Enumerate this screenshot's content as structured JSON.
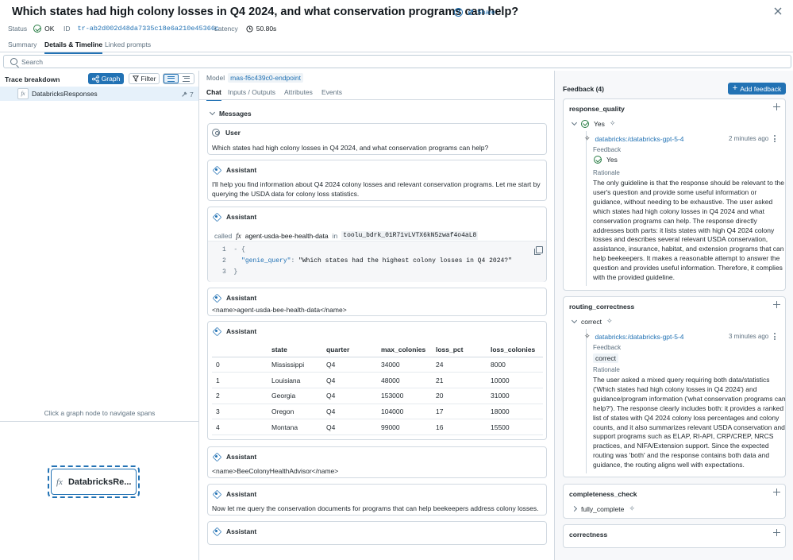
{
  "header": {
    "title": "Which states had high colony losses in Q4 2024, and what conservation programs can help?",
    "help_glyph": "?",
    "share_label": "Share",
    "status_label": "Status",
    "status_value": "OK",
    "id_label": "ID",
    "id_value": "tr-ab2d002d48da7335c18e6a210e45366c",
    "latency_label": "Latency",
    "latency_value": "50.80s",
    "tabs": [
      "Summary",
      "Details & Timeline",
      "Linked prompts"
    ],
    "active_tab": "Details & Timeline"
  },
  "search": {
    "placeholder": "Search"
  },
  "left": {
    "title": "Trace breakdown",
    "graph_label": "Graph",
    "filter_label": "Filter",
    "span_name": "DatabricksResponses",
    "span_count": "7",
    "graph_hint": "Click a graph node to navigate spans",
    "graph_node_label": "DatabricksRe..."
  },
  "middle": {
    "model_label": "Model",
    "model_value": "mas-f6c439c0-endpoint",
    "tabs": [
      "Chat",
      "Inputs / Outputs",
      "Attributes",
      "Events"
    ],
    "messages_label": "Messages",
    "user_role": "User",
    "assistant_role": "Assistant",
    "user_message": "Which states had high colony losses in Q4 2024, and what conservation programs can help?",
    "assistant_1": "I'll help you find information about Q4 2024 colony losses and relevant conservation programs. Let me start by querying the USDA data for colony loss statistics.",
    "called_label": "called",
    "tool_name": "agent-usda-bee-health-data",
    "in_label": "in",
    "tool_call_id": "toolu_bdrk_01R71vLVTX6kN5zwaf4o4aL8",
    "code_line1_num": "1",
    "code_line1": "- {",
    "code_line2_num": "2",
    "code_key": "\"genie_query\"",
    "code_value": "\"Which states had the highest colony losses in Q4 2024?\"",
    "code_line3_num": "3",
    "code_line3": "}",
    "assistant_name_1": "<name>agent-usda-bee-health-data</name>",
    "table": {
      "headers": [
        "",
        "state",
        "quarter",
        "max_colonies",
        "loss_pct",
        "loss_colonies"
      ],
      "rows": [
        [
          "0",
          "Mississippi",
          "Q4",
          "34000",
          "24",
          "8000"
        ],
        [
          "1",
          "Louisiana",
          "Q4",
          "48000",
          "21",
          "10000"
        ],
        [
          "2",
          "Georgia",
          "Q4",
          "153000",
          "20",
          "31000"
        ],
        [
          "3",
          "Oregon",
          "Q4",
          "104000",
          "17",
          "18000"
        ],
        [
          "4",
          "Montana",
          "Q4",
          "99000",
          "16",
          "15500"
        ]
      ]
    },
    "assistant_name_2": "<name>BeeColonyHealthAdvisor</name>",
    "assistant_2": "Now let me query the conservation documents for programs that can help beekeepers address colony losses."
  },
  "right": {
    "title": "Feedback (4)",
    "add_label": "Add feedback",
    "cards": [
      {
        "name": "response_quality",
        "value": "Yes",
        "assessor": "databricks:/databricks-gpt-5-4",
        "ago": "2 minutes ago",
        "feedback_label": "Feedback",
        "feedback_value": "Yes",
        "rationale_label": "Rationale",
        "rationale": "The only guideline is that the response should be relevant to the user's question and provide some useful information or guidance, without needing to be exhaustive. The user asked which states had high colony losses in Q4 2024 and what conservation programs can help. The response directly addresses both parts: it lists states with high Q4 2024 colony losses and describes several relevant USDA conservation, assistance, insurance, habitat, and extension programs that can help beekeepers. It makes a reasonable attempt to answer the question and provides useful information. Therefore, it complies with the provided guideline."
      },
      {
        "name": "routing_correctness",
        "value": "correct",
        "assessor": "databricks:/databricks-gpt-5-4",
        "ago": "3 minutes ago",
        "feedback_label": "Feedback",
        "feedback_value": "correct",
        "rationale_label": "Rationale",
        "rationale": "The user asked a mixed query requiring both data/statistics ('Which states had high colony losses in Q4 2024') and guidance/program information ('what conservation programs can help?'). The response clearly includes both: it provides a ranked list of states with Q4 2024 colony loss percentages and colony counts, and it also summarizes relevant USDA conservation and support programs such as ELAP, RI-API, CRP/CREP, NRCS practices, and NIFA/Extension support. Since the expected routing was 'both' and the response contains both data and guidance, the routing aligns well with expectations."
      },
      {
        "name": "completeness_check",
        "value": "fully_complete"
      },
      {
        "name": "correctness"
      }
    ]
  },
  "colors": {
    "accent": "#2272b4",
    "ok": "#277c43",
    "border": "#d1d9e1"
  },
  "icons": [
    "help-icon",
    "share-icon",
    "close-icon",
    "search-icon",
    "graph-icon",
    "filter-icon",
    "function-icon",
    "user-icon",
    "assistant-icon",
    "copy-icon",
    "check-circle-icon",
    "sparkle-icon",
    "plus-icon",
    "kebab-icon",
    "clock-icon"
  ]
}
